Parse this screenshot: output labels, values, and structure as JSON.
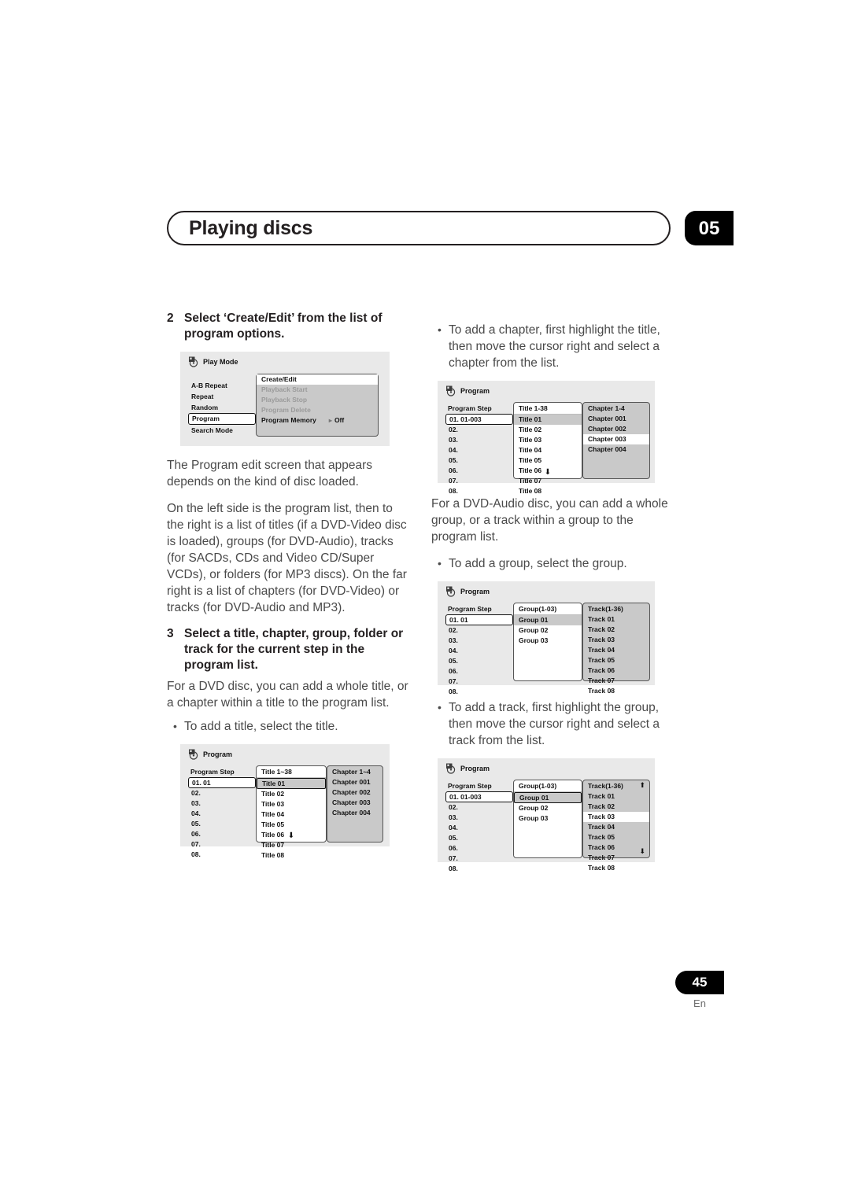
{
  "header": {
    "title": "Playing discs",
    "chapter_number": "05"
  },
  "footer": {
    "page_number": "45",
    "language": "En"
  },
  "left_column": {
    "step2": {
      "number": "2",
      "text": "Select ‘Create/Edit’ from the list of program options."
    },
    "play_mode_screen": {
      "icon": "disc-icon",
      "title": "Play Mode",
      "menu_items": [
        {
          "label": "A-B Repeat",
          "selected": false
        },
        {
          "label": "Repeat",
          "selected": false
        },
        {
          "label": "Random",
          "selected": false
        },
        {
          "label": "Program",
          "selected": true
        },
        {
          "label": "Search Mode",
          "selected": false
        }
      ],
      "panel_items": [
        {
          "label": "Create/Edit",
          "state": "highlighted"
        },
        {
          "label": "Playback Start",
          "state": "dimmed"
        },
        {
          "label": "Playback Stop",
          "state": "dimmed"
        },
        {
          "label": "Program Delete",
          "state": "dimmed"
        },
        {
          "label": "Program Memory",
          "state": "normal",
          "value": "Off",
          "value_arrow": "▸"
        }
      ]
    },
    "para1": "The Program edit screen that appears depends on the kind of disc loaded.",
    "para2": "On the left side is the program list, then to the right is a list of titles (if a DVD-Video disc is loaded), groups (for DVD-Audio), tracks (for SACDs, CDs and Video CD/Super VCDs), or folders (for MP3 discs). On the far right is a list of chapters (for DVD-Video) or tracks (for DVD-Audio and MP3).",
    "step3": {
      "number": "3",
      "text": "Select a title, chapter, group, folder or track for the current step in the program list."
    },
    "para3": "For a DVD disc, you can add a whole title, or a chapter within a title to the program list.",
    "bullet1": "To add a title, select the title.",
    "program_screen_title": {
      "icon": "disc-icon",
      "title": "Program",
      "step_header": "Program Step",
      "steps": [
        "01. 01",
        "02.",
        "03.",
        "04.",
        "05.",
        "06.",
        "07.",
        "08."
      ],
      "selected_step_index": 0,
      "mid_header": "Title 1~38",
      "mid_rows": [
        "Title 01",
        "Title 02",
        "Title 03",
        "Title 04",
        "Title 05",
        "Title 06",
        "Title 07",
        "Title 08"
      ],
      "mid_selected_index": 0,
      "mid_select_style": "box",
      "mid_down_arrow": "⬇",
      "right_header": "Chapter 1~4",
      "right_rows": [
        "Chapter 001",
        "Chapter 002",
        "Chapter 003",
        "Chapter 004"
      ],
      "right_highlight_index": -1,
      "right_up_arrow": "",
      "right_down_arrow": ""
    }
  },
  "right_column": {
    "bullet_chapter": "To add a chapter, first highlight the title, then move the cursor right and select a chapter from the list.",
    "program_screen_chapter": {
      "icon": "disc-icon",
      "title": "Program",
      "step_header": "Program Step",
      "steps": [
        "01. 01-003",
        "02.",
        "03.",
        "04.",
        "05.",
        "06.",
        "07.",
        "08."
      ],
      "selected_step_index": 0,
      "mid_header": "Title 1-38",
      "mid_rows": [
        "Title 01",
        "Title 02",
        "Title 03",
        "Title 04",
        "Title 05",
        "Title 06",
        "Title 07",
        "Title 08"
      ],
      "mid_selected_index": 0,
      "mid_select_style": "fill",
      "mid_down_arrow": "⬇",
      "right_header": "Chapter 1-4",
      "right_rows": [
        "Chapter 001",
        "Chapter 002",
        "Chapter 003",
        "Chapter 004"
      ],
      "right_highlight_index": 2,
      "right_up_arrow": "",
      "right_down_arrow": ""
    },
    "para_dvdaudio": "For a DVD-Audio disc, you can add a whole group, or a track within a group to the program list.",
    "bullet_group": "To add a group, select the group.",
    "program_screen_group": {
      "icon": "disc-icon",
      "title": "Program",
      "step_header": "Program Step",
      "steps": [
        "01. 01",
        "02.",
        "03.",
        "04.",
        "05.",
        "06.",
        "07.",
        "08."
      ],
      "selected_step_index": 0,
      "mid_header": "Group(1-03)",
      "mid_rows": [
        "Group 01",
        "Group 02",
        "Group 03"
      ],
      "mid_selected_index": 0,
      "mid_select_style": "fill",
      "mid_down_arrow": "",
      "right_header": "Track(1-36)",
      "right_rows": [
        "Track 01",
        "Track 02",
        "Track 03",
        "Track 04",
        "Track 05",
        "Track 06",
        "Track 07",
        "Track 08"
      ],
      "right_highlight_index": -1,
      "right_up_arrow": "",
      "right_down_arrow": ""
    },
    "bullet_track": "To add a track, first highlight the group, then move the cursor right and select a track from the list.",
    "program_screen_track": {
      "icon": "disc-icon",
      "title": "Program",
      "step_header": "Program Step",
      "steps": [
        "01. 01-003",
        "02.",
        "03.",
        "04.",
        "05.",
        "06.",
        "07.",
        "08."
      ],
      "selected_step_index": 0,
      "mid_header": "Group(1-03)",
      "mid_rows": [
        "Group 01",
        "Group 02",
        "Group 03"
      ],
      "mid_selected_index": 0,
      "mid_select_style": "box",
      "mid_down_arrow": "",
      "right_header": "Track(1-36)",
      "right_rows": [
        "Track 01",
        "Track 02",
        "Track 03",
        "Track 04",
        "Track 05",
        "Track 06",
        "Track 07",
        "Track 08"
      ],
      "right_highlight_index": 2,
      "right_up_arrow": "⬆",
      "right_down_arrow": "⬇"
    }
  },
  "colors": {
    "ink": "#231f20",
    "body_text": "#4a4a4a",
    "osd_bg": "#e9e9e9",
    "osd_panel": "#c9c9c9",
    "osd_white": "#ffffff",
    "osd_dim": "#9b9b9b"
  }
}
